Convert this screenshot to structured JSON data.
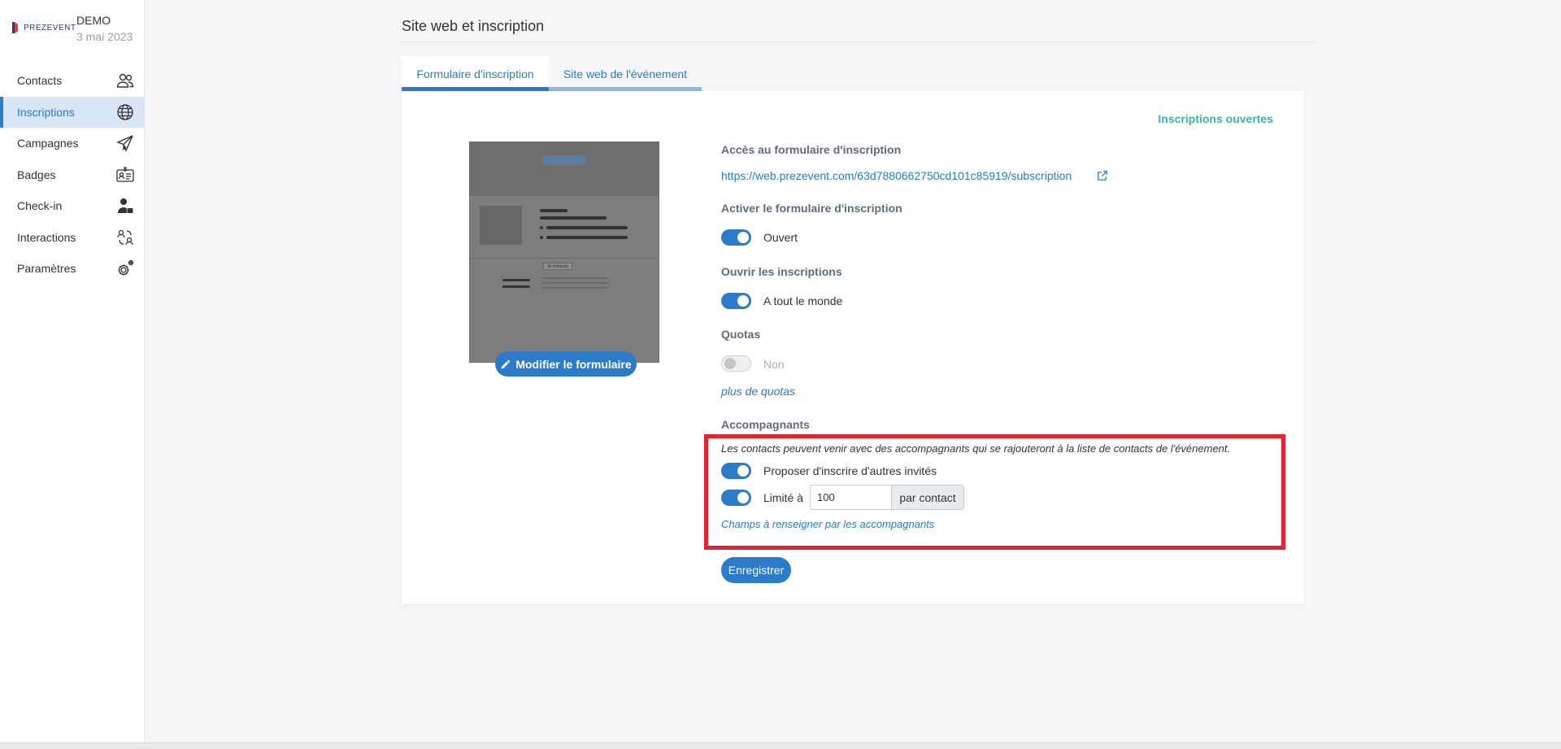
{
  "brand": {
    "logo_text": "PREZEVENT",
    "event_name": "DEMO",
    "event_date": "3 mai 2023"
  },
  "sidebar": {
    "items": [
      {
        "label": "Contacts",
        "icon": "contacts-icon"
      },
      {
        "label": "Inscriptions",
        "icon": "globe-icon",
        "active": true
      },
      {
        "label": "Campagnes",
        "icon": "paper-plane-icon"
      },
      {
        "label": "Badges",
        "icon": "badge-icon"
      },
      {
        "label": "Check-in",
        "icon": "user-check-icon"
      },
      {
        "label": "Interactions",
        "icon": "interactions-icon"
      },
      {
        "label": "Paramètres",
        "icon": "gears-icon"
      }
    ]
  },
  "header": {
    "title": "Site web et inscription"
  },
  "tabs": [
    {
      "label": "Formulaire d'inscription",
      "active": true
    },
    {
      "label": "Site web de l'événement",
      "active": false
    }
  ],
  "preview": {
    "button_text": "Je m'inscris",
    "edit_label": "Modifier le formulaire"
  },
  "status": "Inscriptions ouvertes",
  "form": {
    "access_label": "Accès au formulaire d'inscription",
    "access_url": "https://web.prezevent.com/63d7880662750cd101c85919/subscription",
    "activate_label": "Activer le formulaire d'inscription",
    "activate_value": "Ouvert",
    "open_label": "Ouvrir les inscriptions",
    "open_value": "A tout le monde",
    "quotas_label": "Quotas",
    "quotas_value": "Non",
    "more_quotas": "plus de quotas",
    "companions_label": "Accompagnants",
    "companions_desc": "Les contacts peuvent venir avec des accompagnants qui se rajouteront à la liste de contacts de l'événement.",
    "propose_label": "Proposer d'inscrire d'autres invités",
    "limit_label": "Limité à",
    "limit_value": "100",
    "limit_suffix": "par contact",
    "companion_fields": "Champs à renseigner par les accompagnants",
    "save_label": "Enregistrer"
  },
  "colors": {
    "accent": "#2b7bc8",
    "status": "#3ab7a0",
    "highlight": "#e3232f"
  }
}
